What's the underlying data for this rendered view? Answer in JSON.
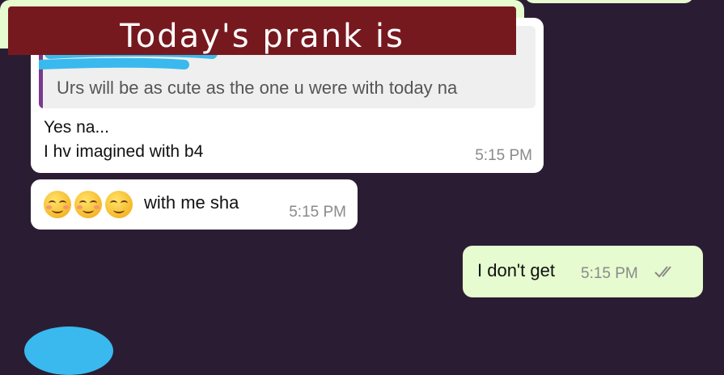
{
  "colors": {
    "background": "#2a1d33",
    "incoming_bubble": "#ffffff",
    "outgoing_bubble": "#e6fbcf",
    "quote_bar": "#7a3a8e",
    "scribble": "#39b9ee",
    "image_banner": "#76191f"
  },
  "messages": {
    "quoted": {
      "quote_text": "Urs will be as cute as the one u were with today na",
      "line1": "Yes na...",
      "line2": "I hv imagined with b4",
      "time": "5:15 PM"
    },
    "emoji_msg": {
      "emojis": [
        "smiling-face-icon",
        "smiling-face-icon",
        "relieved-face-icon"
      ],
      "text": "with me sha",
      "time": "5:15 PM"
    },
    "outgoing": {
      "text": "I don't get",
      "time": "5:15 PM",
      "status_icon": "double-check-icon"
    },
    "image_message": {
      "caption": "Today's prank is"
    }
  }
}
